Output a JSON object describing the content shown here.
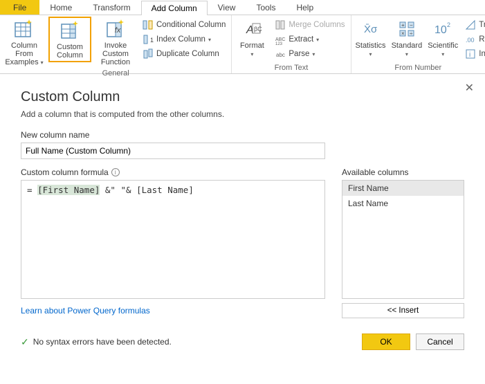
{
  "tabs": {
    "file": "File",
    "home": "Home",
    "transform": "Transform",
    "addcolumn": "Add Column",
    "view": "View",
    "tools": "Tools",
    "help": "Help"
  },
  "ribbon": {
    "general": {
      "label": "General",
      "colFromExamples": "Column From Examples",
      "customColumn": "Custom Column",
      "invokeCustom": "Invoke Custom Function",
      "conditional": "Conditional Column",
      "indexCol": "Index Column",
      "duplicateCol": "Duplicate Column"
    },
    "fromText": {
      "label": "From Text",
      "format": "Format",
      "merge": "Merge Columns",
      "extract": "Extract",
      "parse": "Parse"
    },
    "fromNumber": {
      "label": "From Number",
      "statistics": "Statistics",
      "standard": "Standard",
      "scientific": "Scientific",
      "trig": "Trig",
      "rounding": "Rou",
      "info": "Info"
    }
  },
  "dialog": {
    "title": "Custom Column",
    "subtitle": "Add a column that is computed from the other columns.",
    "newColLabel": "New column name",
    "newColValue": "Full Name (Custom Column)",
    "formulaLabel": "Custom column formula",
    "formulaPrefix": "= ",
    "formulaField1": "[First Name]",
    "formulaMid": " &\" \"& ",
    "formulaField2": "[Last Name]",
    "availLabel": "Available columns",
    "availItems": [
      "First Name",
      "Last Name"
    ],
    "insertBtn": "<< Insert",
    "learnLink": "Learn about Power Query formulas",
    "status": "No syntax errors have been detected.",
    "ok": "OK",
    "cancel": "Cancel"
  }
}
